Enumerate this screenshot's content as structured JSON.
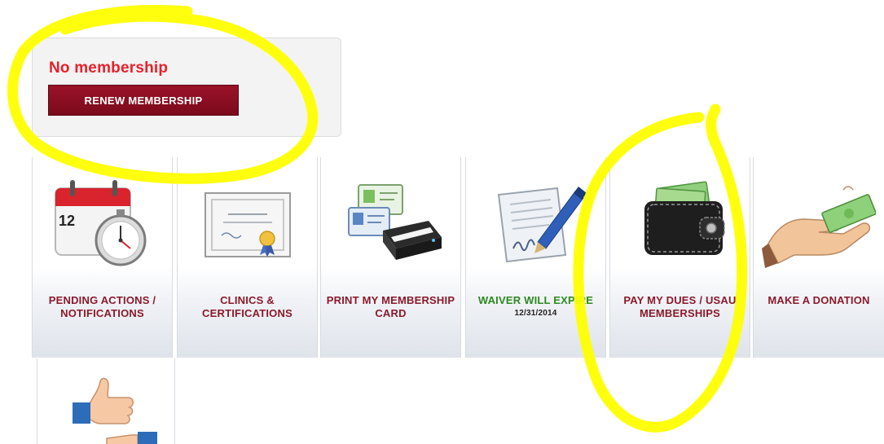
{
  "membership": {
    "status_text": "No membership",
    "renew_label": "RENEW MEMBERSHIP"
  },
  "tiles": [
    {
      "label": "PENDING ACTIONS / NOTIFICATIONS",
      "icon": "calendar-stopwatch-icon",
      "calendar_day": "12"
    },
    {
      "label": "CLINICS & CERTIFICATIONS",
      "icon": "certificate-icon"
    },
    {
      "label": "PRINT MY MEMBERSHIP CARD",
      "icon": "printer-card-icon"
    },
    {
      "label": "WAIVER WILL EXPIRE",
      "sublabel": "12/31/2014",
      "icon": "signed-document-pen-icon"
    },
    {
      "label": "PAY MY DUES / USAU MEMBERSHIPS",
      "icon": "wallet-icon"
    },
    {
      "label": "MAKE A DONATION",
      "icon": "hand-money-icon"
    }
  ],
  "partial_tile": {
    "icon": "handshake-thumbs-up-icon"
  },
  "colors": {
    "status_red": "#e8202a",
    "button_maroon": "#8a0f22",
    "tile_label": "#8b1a2b",
    "waiver_green": "#2c8a1f",
    "highlight_yellow": "#ffff00"
  }
}
